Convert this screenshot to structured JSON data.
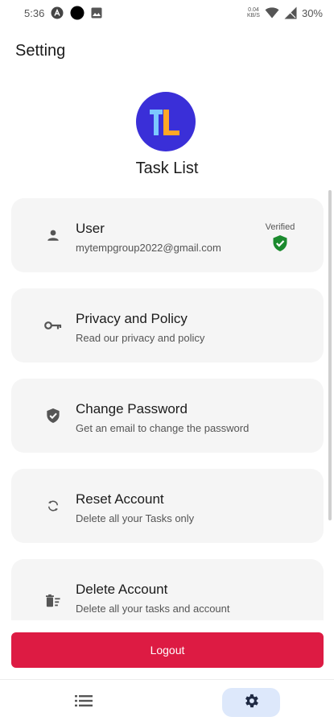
{
  "status_bar": {
    "time": "5:36",
    "net_speed": "0.04",
    "net_unit": "KB/S",
    "battery": "30%",
    "icons": [
      "a-icon",
      "circle-icon",
      "image-icon",
      "wifi-icon",
      "signal-icon"
    ]
  },
  "header": {
    "title": "Setting"
  },
  "app": {
    "name": "Task List",
    "logo_text": "TL",
    "logo_bg": "#3a2fd8",
    "logo_t_color": "#7cc8ff",
    "logo_l_color": "#ffa726"
  },
  "cards": [
    {
      "icon": "person-icon",
      "title": "User",
      "subtitle": "mytempgroup2022@gmail.com",
      "verified_label": "Verified"
    },
    {
      "icon": "key-icon",
      "title": "Privacy and Policy",
      "subtitle": "Read our privacy and policy"
    },
    {
      "icon": "shield-check-icon",
      "title": "Change Password",
      "subtitle": "Get an email to change the password"
    },
    {
      "icon": "sync-icon",
      "title": "Reset Account",
      "subtitle": "Delete all your Tasks only"
    },
    {
      "icon": "delete-sweep-icon",
      "title": "Delete Account",
      "subtitle": "Delete all your tasks and account"
    }
  ],
  "logout": {
    "label": "Logout",
    "color": "#dd1b43"
  },
  "bottom_nav": {
    "items": [
      {
        "icon": "list-icon",
        "selected": false
      },
      {
        "icon": "gear-icon",
        "selected": true
      }
    ],
    "selected_bg": "#dde8fb"
  },
  "colors": {
    "verified_green": "#1b8a2e",
    "card_bg": "#f5f5f5"
  }
}
